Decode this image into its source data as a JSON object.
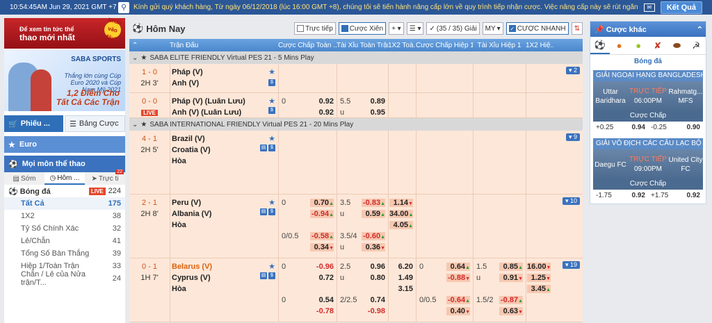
{
  "topbar": {
    "time": "10:54:45AM Jun 29, 2021 GMT +7",
    "marquee": "Kính gửi quý khách hàng, Từ ngày 06/12/2018 (lúc 16:00 GMT +8), chúng tôi sẽ tiến hành nâng cấp lớn về quy trình tiếp nhận cược. Việc nâng cấp này sẽ rút ngắn",
    "ket_qua": "Kết Quả"
  },
  "left": {
    "banner": {
      "line1": "Để xem tin tức thể",
      "line2": "thao mới nhất",
      "tag": "Nhấn vào đây!"
    },
    "promo": {
      "brand": "SABA SPORTS",
      "line1": "Thắng lớn cùng Cúp Euro 2020 và Cúp Nam Mỹ 2021",
      "line2": "1,2 Điểm Cho Tất Cả Các Trận"
    },
    "phieu": "Phiếu ...",
    "bang_cuoc": "Bảng Cược",
    "euro": "Euro",
    "moi_mon": "Mọi môn thể thao",
    "tabs": [
      {
        "label": "Sớm"
      },
      {
        "label": "Hôm ..."
      },
      {
        "label": "Trực ti"
      }
    ],
    "tabs_badge": "22",
    "sport": {
      "name": "Bóng đá",
      "live": "LIVE",
      "count": "224"
    },
    "subs": [
      {
        "label": "Tất Cả",
        "count": "175"
      },
      {
        "label": "1X2",
        "count": "38"
      },
      {
        "label": "Tỷ Số Chính Xác",
        "count": "32"
      },
      {
        "label": "Lẻ/Chẵn",
        "count": "41"
      },
      {
        "label": "Tổng Số Bàn Thắng",
        "count": "39"
      },
      {
        "label": "Hiệp 1/Toàn Trận",
        "count": "33"
      },
      {
        "label": "Chẵn / Lẻ của Nửa trận/T...",
        "count": "24"
      }
    ]
  },
  "main": {
    "title": "Hôm Nay",
    "toolbar": {
      "truc_tiep": "Trực tiếp",
      "cuoc_xien": "Cược Xiên",
      "giai": "(35 / 35) Giải",
      "my": "MY",
      "cuoc_nhanh": "CƯỢC NHANH"
    },
    "headers": [
      "Trận Đấu",
      "Cược Chấp Toàn ...",
      "Tài Xỉu Toàn Trận",
      "1X2 Toà...",
      "Cược Chấp Hiệp 1",
      "Tài Xỉu Hiệp 1",
      "1X2 Hiệ..."
    ],
    "leagues": [
      {
        "name": "SABA ELITE FRIENDLY Virtual PES 21 - 5 Mins Play",
        "matches": [
          {
            "score": "1 - 0",
            "time": "2H 3'",
            "home": "Pháp (V)",
            "away": "Anh (V)",
            "more": "2",
            "rows": []
          },
          {
            "score": "0 - 0",
            "time": "LIVE",
            "home": "Pháp (V) (Luân Lưu)",
            "away": "Anh (V) (Luân Lưu)",
            "more": "",
            "rows": [
              {
                "hdp": "0",
                "h1": "0.92",
                "ou": "5.5",
                "o1": "0.89"
              },
              {
                "hdp": "",
                "h1": "0.92",
                "ou": "u",
                "o1": "0.95"
              }
            ]
          }
        ]
      },
      {
        "name": "SABA INTERNATIONAL FRIENDLY Virtual PES 21 - 20 Mins Play",
        "matches": [
          {
            "score": "4 - 1",
            "time": "2H 5'",
            "home": "Brazil (V)",
            "away": "Croatia (V)",
            "draw": "Hòa",
            "more": "9"
          },
          {
            "score": "2 - 1",
            "time": "2H 8'",
            "home": "Peru (V)",
            "away": "Albania (V)",
            "draw": "Hòa",
            "more": "10"
          },
          {
            "score": "0 - 1",
            "time": "1H 7'",
            "home": "Belarus (V)",
            "away": "Cyprus (V)",
            "draw": "Hòa",
            "more": "19"
          }
        ]
      }
    ],
    "peru": {
      "r1": {
        "hdp": "0",
        "h": "0.70",
        "ou": "3.5",
        "o": "-0.83",
        "x": "1.14"
      },
      "r2": {
        "h": "-0.94",
        "ou": "u",
        "o": "0.59",
        "x": "34.00"
      },
      "r3": {
        "x": "4.05"
      },
      "r4": {
        "hdp": "0/0.5",
        "h": "-0.58",
        "ou": "3.5/4",
        "o": "-0.60"
      },
      "r5": {
        "h": "0.34",
        "ou": "u",
        "o": "0.36"
      }
    },
    "belarus": {
      "r1": {
        "hdp": "0",
        "h": "-0.96",
        "ou": "2.5",
        "o": "0.96",
        "x": "6.20",
        "hdp1": "0",
        "h1": "0.64",
        "ou1": "1.5",
        "o1": "0.85",
        "x1": "16.00"
      },
      "r2": {
        "h": "0.72",
        "ou": "u",
        "o": "0.80",
        "x": "1.49",
        "h1": "-0.88",
        "ou1": "u",
        "o1": "0.91",
        "x1": "1.25"
      },
      "r3": {
        "x": "3.15",
        "x1": "3.45"
      },
      "r4": {
        "hdp": "0",
        "h": "0.54",
        "ou": "2/2.5",
        "o": "0.74",
        "hdp1": "0/0.5",
        "h1": "-0.64",
        "ou1": "1.5/2",
        "o1": "-0.87"
      },
      "r5": {
        "h": "-0.78",
        "o": "-0.98",
        "h1": "0.40",
        "o1": "0.63"
      }
    }
  },
  "right": {
    "title": "Cược khác",
    "sport": "Bóng đá",
    "cards": [
      {
        "league": "GIẢI NGOẠI HẠNG BANGLADESH",
        "home": "Uttar Baridhara",
        "away": "Rahmatg... MFS",
        "status": "TRỰC TIẾP",
        "time": "06:00PM",
        "label": "Cược Chấp",
        "h": "+0.25",
        "hv": "0.94",
        "a": "-0.25",
        "av": "0.90"
      },
      {
        "league": "GIẢI VÔ ĐỊCH CÁC CÂU LẠC BỘ CH...",
        "home": "Daegu FC",
        "away": "United City FC",
        "status": "TRỰC TIẾP",
        "time": "09:00PM",
        "label": "Cược Chấp",
        "h": "-1.75",
        "hv": "0.92",
        "a": "+1.75",
        "av": "0.92"
      }
    ]
  }
}
